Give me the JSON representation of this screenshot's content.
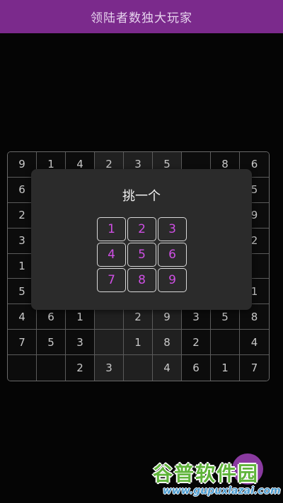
{
  "app": {
    "title": "领陆者数独大玩家"
  },
  "board": {
    "rows": [
      [
        "9",
        "1",
        "4",
        "2",
        "3",
        "5",
        "",
        "8",
        "6"
      ],
      [
        "6",
        "",
        "",
        "",
        "",
        "",
        "",
        "",
        "5"
      ],
      [
        "2",
        "",
        "",
        "",
        "",
        "",
        "",
        "",
        "9"
      ],
      [
        "3",
        "",
        "",
        "",
        "",
        "",
        "",
        "",
        "2"
      ],
      [
        "1",
        "",
        "",
        "",
        "",
        "",
        "",
        "",
        ""
      ],
      [
        "5",
        "",
        "",
        "",
        "",
        "",
        "",
        "",
        "1"
      ],
      [
        "4",
        "6",
        "1",
        "",
        "2",
        "9",
        "3",
        "5",
        "8"
      ],
      [
        "7",
        "5",
        "3",
        "",
        "1",
        "8",
        "2",
        "",
        "4"
      ],
      [
        "",
        "",
        "2",
        "3",
        "",
        "4",
        "6",
        "1",
        "7"
      ]
    ],
    "user_cells": [
      [
        0,
        3
      ],
      [
        6,
        3
      ],
      [
        6,
        4
      ],
      [
        6,
        5
      ],
      [
        7,
        3
      ],
      [
        7,
        4
      ],
      [
        7,
        5
      ],
      [
        8,
        3
      ],
      [
        8,
        4
      ],
      [
        8,
        5
      ],
      [
        0,
        4
      ],
      [
        0,
        5
      ]
    ]
  },
  "picker": {
    "title": "挑一个",
    "options": [
      "1",
      "2",
      "3",
      "4",
      "5",
      "6",
      "7",
      "8",
      "9"
    ]
  },
  "watermark": {
    "main": "谷普软件园",
    "url": "www.gupuxlazai.com"
  },
  "colors": {
    "appbar": "#7b2a8c",
    "accent": "#cf4fe4",
    "background": "#050505"
  }
}
